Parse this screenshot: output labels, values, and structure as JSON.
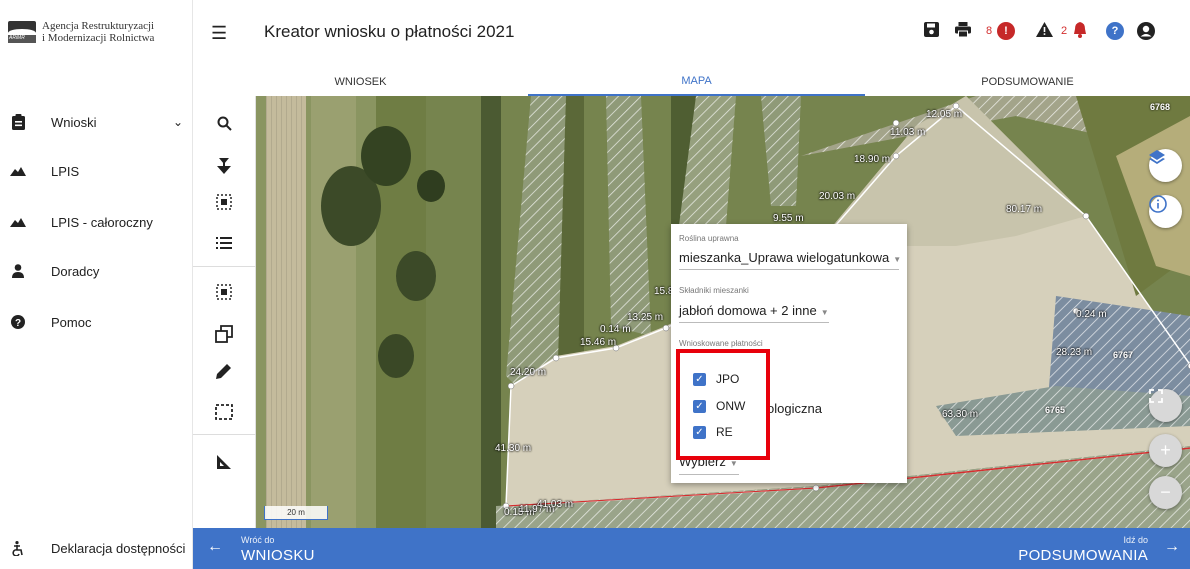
{
  "org": {
    "logo_badge": "ARiMR",
    "name_line1": "Agencja Restrukturyzacji",
    "name_line2": "i Modernizacji Rolnictwa"
  },
  "sidebar": {
    "items": [
      {
        "label": "Wnioski",
        "icon": "clipboard-icon"
      },
      {
        "label": "LPIS",
        "icon": "mountain-icon"
      },
      {
        "label": "LPIS - całoroczny",
        "icon": "mountain-icon"
      },
      {
        "label": "Doradcy",
        "icon": "person-icon"
      },
      {
        "label": "Pomoc",
        "icon": "help-icon"
      }
    ],
    "accessibility": "Deklaracja dostępności"
  },
  "header": {
    "title": "Kreator wniosku o płatności 2021",
    "errors_count": "8",
    "warnings_count": "2",
    "accent": "#3f73c8"
  },
  "tabs": [
    {
      "label": "WNIOSEK",
      "active": false
    },
    {
      "label": "MAPA",
      "active": true
    },
    {
      "label": "PODSUMOWANIE",
      "active": false
    }
  ],
  "map": {
    "measurements": [
      "12.05 m",
      "11.03 m",
      "18.90 m",
      "20.03 m",
      "9.55 m",
      "80.17 m",
      "15.8",
      "13.25 m",
      "0.14 m",
      "15.46 m",
      "24.20 m",
      "41.30 m",
      "0.15 m",
      "11.97 m",
      "41.03 m",
      "0.24 m",
      "28.23 m",
      "63.30 m"
    ],
    "parcels": [
      "6768",
      "6767",
      "6765"
    ],
    "scale": "20 m",
    "zoom_hint": "50"
  },
  "popup": {
    "crop_label": "Roślina uprawna",
    "crop_value": "mieszanka_Uprawa wielogatunkowa",
    "components_label": "Składniki mieszanki",
    "components_value": "jabłoń domowa + 2 inne",
    "payments_label": "Wnioskowane płatności",
    "payments": [
      "JPO",
      "ONW",
      "RE"
    ],
    "hidden_text": "ologiczna",
    "select_label": "Wybierz"
  },
  "footer": {
    "back_small": "Wróć do",
    "back_big": "WNIOSKU",
    "next_small": "Idź do",
    "next_big": "PODSUMOWANIA"
  }
}
